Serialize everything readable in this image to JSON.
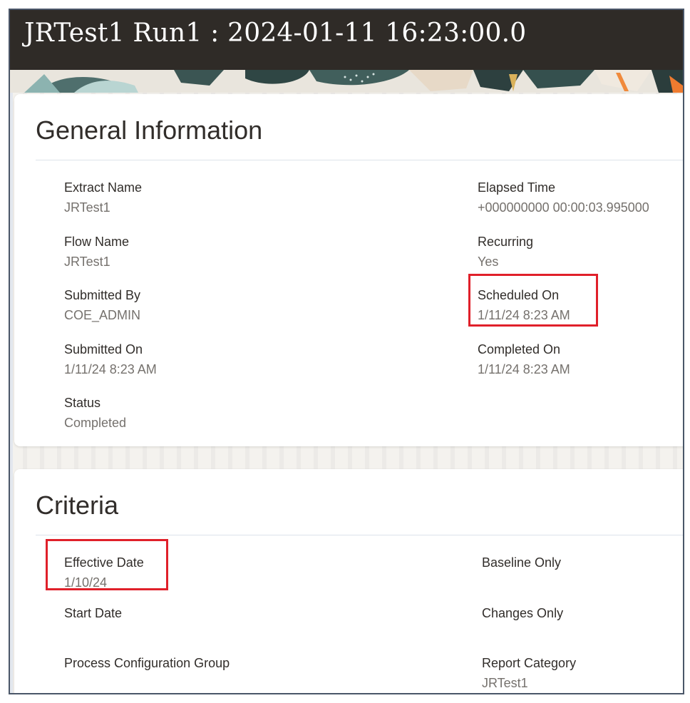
{
  "page": {
    "title": "JRTest1 Run1 : 2024-01-11 16:23:00.0"
  },
  "colors": {
    "title_bar": "#2f2b27",
    "label_text": "#312d2a",
    "value_text": "#75716d",
    "highlight_border": "#e0202a"
  },
  "general": {
    "heading": "General Information",
    "fields": {
      "extract_name": {
        "label": "Extract Name",
        "value": "JRTest1"
      },
      "elapsed_time": {
        "label": "Elapsed Time",
        "value": "+000000000 00:00:03.995000"
      },
      "flow_name": {
        "label": "Flow Name",
        "value": "JRTest1"
      },
      "recurring": {
        "label": "Recurring",
        "value": "Yes"
      },
      "submitted_by": {
        "label": "Submitted By",
        "value": "COE_ADMIN"
      },
      "scheduled_on": {
        "label": "Scheduled On",
        "value": "1/11/24 8:23 AM"
      },
      "submitted_on": {
        "label": "Submitted On",
        "value": "1/11/24 8:23 AM"
      },
      "completed_on": {
        "label": "Completed On",
        "value": "1/11/24 8:23 AM"
      },
      "status": {
        "label": "Status",
        "value": "Completed"
      }
    }
  },
  "criteria": {
    "heading": "Criteria",
    "fields": {
      "effective_date": {
        "label": "Effective Date",
        "value": "1/10/24"
      },
      "baseline_only": {
        "label": "Baseline Only",
        "value": ""
      },
      "start_date": {
        "label": "Start Date",
        "value": ""
      },
      "changes_only": {
        "label": "Changes Only",
        "value": ""
      },
      "process_configuration_group": {
        "label": "Process Configuration Group",
        "value": ""
      },
      "report_category": {
        "label": "Report Category",
        "value": "JRTest1"
      }
    }
  }
}
